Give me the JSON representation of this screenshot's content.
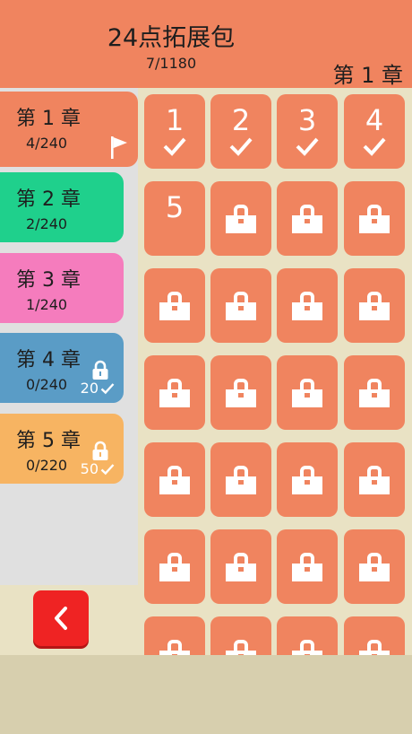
{
  "header": {
    "title": "24点拓展包",
    "progress": "7/1180",
    "current_chapter": "第 1 章",
    "color": "#f0845f"
  },
  "chapters": [
    {
      "name": "第 1 章",
      "count": "4/240",
      "color": "#f0845f",
      "locked": false,
      "active": true
    },
    {
      "name": "第 2 章",
      "count": "2/240",
      "color": "#1fd08c",
      "locked": false,
      "active": false
    },
    {
      "name": "第 3 章",
      "count": "1/240",
      "color": "#f57cbd",
      "locked": false,
      "active": false
    },
    {
      "name": "第 4 章",
      "count": "0/240",
      "color": "#5a9cc6",
      "locked": true,
      "required": "20",
      "active": false
    },
    {
      "name": "第 5 章",
      "count": "0/220",
      "color": "#f7b462",
      "locked": true,
      "required": "50",
      "active": false
    }
  ],
  "back_button": {
    "icon": "chevron-left-icon",
    "color": "#ef2323"
  },
  "levels": [
    {
      "label": "1",
      "state": "solved"
    },
    {
      "label": "2",
      "state": "solved"
    },
    {
      "label": "3",
      "state": "solved"
    },
    {
      "label": "4",
      "state": "solved"
    },
    {
      "label": "5",
      "state": "open"
    }
  ],
  "locked_level_icon": "lock-icon",
  "level_color": "#f0845f"
}
